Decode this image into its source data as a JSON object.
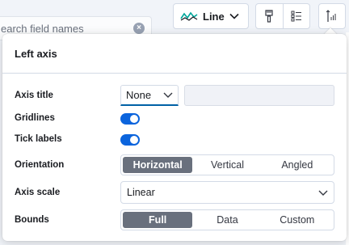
{
  "background": {
    "search_placeholder": "earch field names",
    "chart_type_label": "Line",
    "icons": [
      "line-chart-icon",
      "paintbrush-icon",
      "list-settings-icon",
      "left-axis-icon"
    ]
  },
  "popover": {
    "title": "Left axis",
    "axis_title": {
      "label": "Axis title",
      "select_value": "None",
      "text_value": ""
    },
    "gridlines": {
      "label": "Gridlines",
      "on": true
    },
    "tick_labels": {
      "label": "Tick labels",
      "on": true
    },
    "orientation": {
      "label": "Orientation",
      "options": [
        "Horizontal",
        "Vertical",
        "Angled"
      ],
      "selected": "Horizontal"
    },
    "axis_scale": {
      "label": "Axis scale",
      "value": "Linear"
    },
    "bounds": {
      "label": "Bounds",
      "options": [
        "Full",
        "Data",
        "Custom"
      ],
      "selected": "Full"
    }
  },
  "colors": {
    "accent": "#0b64dd",
    "selected_option_bg": "#69707d",
    "line_icon": "#00a69b"
  }
}
